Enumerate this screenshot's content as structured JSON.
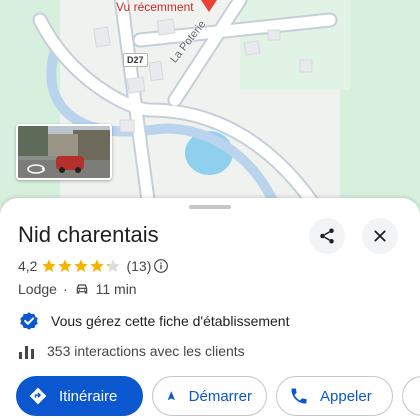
{
  "map": {
    "recent_label": "Vu récemment",
    "road_badge": "D27",
    "street_name": "La Poterie",
    "colors": {
      "road": "#ffffff",
      "road_outline": "#c9d3dc",
      "river": "#aed4e6",
      "water": "#8fd1ec",
      "green": "#d3f0dc",
      "pin": "#ea4335"
    },
    "streetview_thumb_icon": "rotate-360-icon"
  },
  "place": {
    "name": "Nid charentais",
    "rating": "4,2",
    "stars": 4.2,
    "review_count": "(13)",
    "category": "Lodge",
    "separator": "·",
    "travel_time": "11 min",
    "travel_mode_icon": "car-icon",
    "verified_text": "Vous gérez cette fiche d'établissement",
    "interactions_text": "353 interactions avec les clients"
  },
  "actions": {
    "directions": "Itinéraire",
    "start": "Démarrer",
    "call": "Appeler"
  },
  "icons": {
    "share": "share-icon",
    "close": "close-icon",
    "info": "info-icon",
    "verified": "verified-badge-icon",
    "stats": "bar-chart-icon",
    "directions": "directions-icon",
    "navigation": "navigation-arrow-icon",
    "phone": "phone-icon"
  },
  "colors": {
    "accent": "#0b57d0",
    "star": "#f4b400",
    "star_empty": "#dadce0"
  }
}
